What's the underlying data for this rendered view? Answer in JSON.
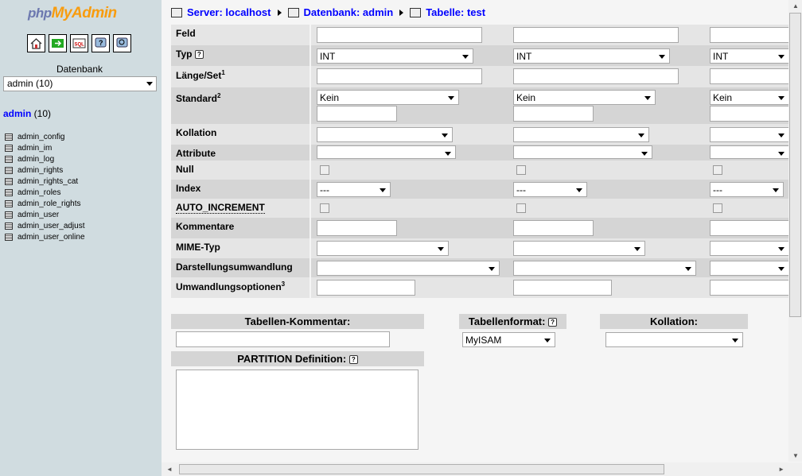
{
  "nav": {
    "logo_php": "php",
    "logo_myadmin": "MyAdmin",
    "icons": [
      "home-icon",
      "exit-icon",
      "sql-icon",
      "docs-icon",
      "query-icon"
    ],
    "db_label": "Datenbank",
    "db_selected": "admin (10)",
    "db_heading": "admin",
    "db_heading_count": " (10)",
    "tables": [
      "admin_config",
      "admin_im",
      "admin_log",
      "admin_rights",
      "admin_rights_cat",
      "admin_roles",
      "admin_role_rights",
      "admin_user",
      "admin_user_adjust",
      "admin_user_online"
    ]
  },
  "breadcrumb": {
    "server": "Server: localhost",
    "database": "Datenbank: admin",
    "table": "Tabelle: test"
  },
  "fields": {
    "labels": {
      "feld": "Feld",
      "typ": "Typ",
      "laenge": "Länge/Set",
      "laenge_sup": "1",
      "standard": "Standard",
      "standard_sup": "2",
      "kollation": "Kollation",
      "attribute": "Attribute",
      "null": "Null",
      "index": "Index",
      "auto_increment": "AUTO_INCREMENT",
      "kommentare": "Kommentare",
      "mime": "MIME-Typ",
      "darstellung": "Darstellungsumwandlung",
      "umwandlung": "Umwandlungsoptionen",
      "umwandlung_sup": "3"
    },
    "typ_value": "INT",
    "standard_value": "Kein",
    "index_value": "---"
  },
  "bottom": {
    "kommentar_label": "Tabellen-Kommentar:",
    "format_label": "Tabellenformat:",
    "format_value": "MyISAM",
    "kollation_label": "Kollation:",
    "partition_label": "PARTITION Definition:"
  }
}
